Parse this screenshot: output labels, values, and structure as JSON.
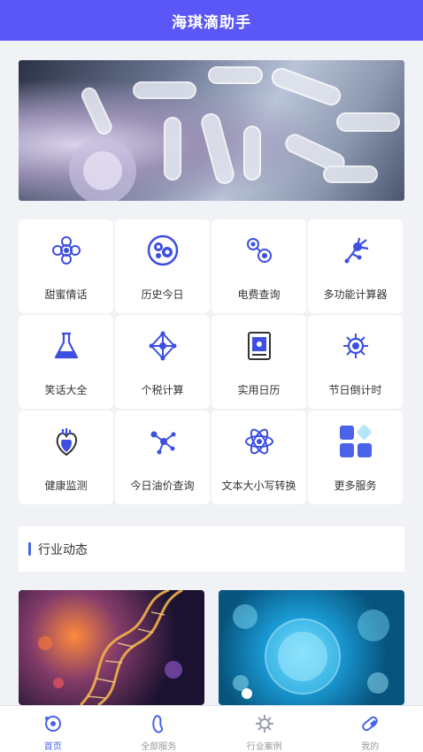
{
  "header": {
    "title": "海琪滴助手"
  },
  "banner": {
    "dot_count": 3,
    "active_dot": 1
  },
  "services": [
    {
      "label": "甜蜜情话",
      "icon": "flower-ring-icon"
    },
    {
      "label": "历史今日",
      "icon": "cells-circle-icon"
    },
    {
      "label": "电费查询",
      "icon": "molecule-dots-icon"
    },
    {
      "label": "多功能计算器",
      "icon": "neuron-icon"
    },
    {
      "label": "笑话大全",
      "icon": "flask-icon"
    },
    {
      "label": "个税计算",
      "icon": "network-node-icon"
    },
    {
      "label": "实用日历",
      "icon": "calendar-card-icon"
    },
    {
      "label": "节日倒计时",
      "icon": "virus-icon"
    },
    {
      "label": "健康监测",
      "icon": "heart-organ-icon"
    },
    {
      "label": "今日油价查询",
      "icon": "node-graph-icon"
    },
    {
      "label": "文本大小写转换",
      "icon": "atom-icon"
    },
    {
      "label": "更多服务",
      "icon": "more-grid-icon"
    }
  ],
  "section": {
    "title": "行业动态"
  },
  "tabs": [
    {
      "label": "首页",
      "icon": "home-cell-icon",
      "active": true
    },
    {
      "label": "全部服务",
      "icon": "all-services-icon",
      "active": false
    },
    {
      "label": "行业案例",
      "icon": "industry-case-icon",
      "active": false
    },
    {
      "label": "我的",
      "icon": "profile-capsule-icon",
      "active": false
    }
  ],
  "colors": {
    "brand": "#5b56f6",
    "accent": "#4a63e8",
    "icon_blue": "#3d4fe0"
  }
}
